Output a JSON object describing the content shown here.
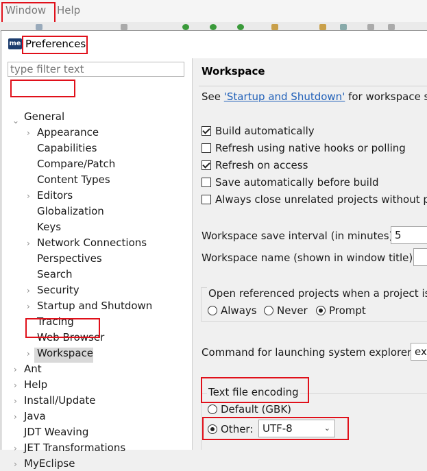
{
  "menubar": {
    "items": [
      "Window",
      "Help"
    ]
  },
  "dialog": {
    "title": "Preferences",
    "icon_text": "me"
  },
  "filter": {
    "placeholder": "type filter text"
  },
  "tree": {
    "general": "General",
    "children": [
      "Appearance",
      "Capabilities",
      "Compare/Patch",
      "Content Types",
      "Editors",
      "Globalization",
      "Keys",
      "Network Connections",
      "Perspectives",
      "Search",
      "Security",
      "Startup and Shutdown",
      "Tracing",
      "Web Browser",
      "Workspace"
    ],
    "top_level": [
      "Ant",
      "Help",
      "Install/Update",
      "Java",
      "JDT Weaving",
      "JET Transformations",
      "MyEclipse"
    ]
  },
  "workspace": {
    "title": "Workspace",
    "see_prefix": "See ",
    "see_link": "'Startup and Shutdown'",
    "see_suffix": " for workspace sta",
    "checkboxes": [
      {
        "label": "Build automatically",
        "checked": true
      },
      {
        "label": "Refresh using native hooks or polling",
        "checked": false
      },
      {
        "label": "Refresh on access",
        "checked": true
      },
      {
        "label": "Save automatically before build",
        "checked": false
      },
      {
        "label": "Always close unrelated projects without pr",
        "checked": false
      }
    ],
    "save_interval_label": "Workspace save interval (in minutes):",
    "save_interval_value": "5",
    "name_label": "Workspace name (shown in window title):",
    "name_value": "",
    "open_ref_label": "Open referenced projects when a project is o",
    "open_ref_options": [
      "Always",
      "Never",
      "Prompt"
    ],
    "open_ref_selected": "Prompt",
    "explorer_label": "Command for launching system explorer:",
    "explorer_value": "exp",
    "encoding": {
      "title": "Text file encoding",
      "default_label": "Default (GBK)",
      "other_label": "Other:",
      "other_value": "UTF-8",
      "selected": "Other"
    }
  },
  "colors": {
    "highlight": "#e0101a",
    "link": "#1f5fb8",
    "selection": "#d9d9d9"
  }
}
